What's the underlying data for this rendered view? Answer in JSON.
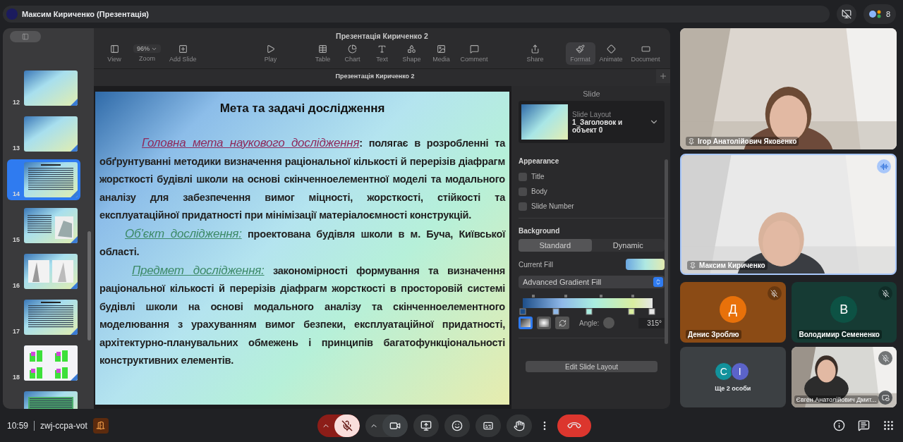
{
  "presenter_bar": {
    "label": "Максим Кириченко (Презентація)"
  },
  "top_controls": {
    "participants_count": "8"
  },
  "keynote": {
    "window_title": "Презентація Кириченко 2",
    "toolbar": [
      {
        "kind": "view",
        "label": "View",
        "selected": false
      },
      {
        "kind": "zoom",
        "label": "Zoom",
        "value": "96%",
        "selected": false
      },
      {
        "kind": "add_slide",
        "label": "Add Slide",
        "selected": false
      },
      {
        "kind": "play",
        "label": "Play",
        "selected": false
      },
      {
        "kind": "table",
        "label": "Table",
        "selected": false
      },
      {
        "kind": "chart",
        "label": "Chart",
        "selected": false
      },
      {
        "kind": "text",
        "label": "Text",
        "selected": false
      },
      {
        "kind": "shape",
        "label": "Shape",
        "selected": false
      },
      {
        "kind": "media",
        "label": "Media",
        "selected": false
      },
      {
        "kind": "comment",
        "label": "Comment",
        "selected": false
      },
      {
        "kind": "share",
        "label": "Share",
        "selected": false
      },
      {
        "kind": "format",
        "label": "Format",
        "selected": true
      },
      {
        "kind": "animate",
        "label": "Animate",
        "selected": false
      },
      {
        "kind": "document",
        "label": "Document",
        "selected": false
      }
    ],
    "document_tab": "Презентація Кириченко 2",
    "slides": [
      {
        "number": "12",
        "kind": "gradient",
        "selected": false
      },
      {
        "number": "13",
        "kind": "gradient",
        "selected": false
      },
      {
        "number": "14",
        "kind": "text",
        "selected": true
      },
      {
        "number": "15",
        "kind": "diagram",
        "selected": false
      },
      {
        "number": "16",
        "kind": "photos",
        "selected": false
      },
      {
        "number": "17",
        "kind": "text",
        "selected": false
      },
      {
        "number": "18",
        "kind": "charts",
        "selected": false
      },
      {
        "kind": "table",
        "selected": false
      }
    ],
    "slide": {
      "title": "Мета та задачі дослідження",
      "paragraphs": [
        {
          "lead": "Головна мета наукового дослідження",
          "color": "#8e2a5c",
          "text": ": полягає в розробленні та обґрунтуванні методики визначення раціональної кількості й перерізів діафрагм жорсткості будівлі школи на основі скінченноелементної моделі та модального аналізу для забезпечення вимог міцності, жорсткості, стійкості та експлуатаційної придатності при мінімізації матеріалоємності конструкцій."
        },
        {
          "lead": "Об’єкт дослідження:",
          "color": "#3d8a68",
          "text": " проектована будівля школи в м. Буча, Київської області."
        },
        {
          "lead": "Предмет дослідження:",
          "color": "#3d8a68",
          "text": " закономірності формування та визначення раціональної кількості й перерізів діафрагм жорсткості в просторовій системі будівлі школи на основі модального аналізу та скінченноелементного моделювання з урахуванням вимог безпеки, експлуатаційної придатності, архітектурно-планувальних обмежень і принципів багатофункціональності конструктивних елементів."
        }
      ]
    },
    "inspector": {
      "header": "Slide",
      "layout_label": "Slide Layout",
      "layout_value": "1_Заголовок и объект 0",
      "appearance": {
        "heading": "Appearance",
        "options": [
          {
            "label": "Title",
            "checked": false
          },
          {
            "label": "Body",
            "checked": false
          },
          {
            "label": "Slide Number",
            "checked": false
          }
        ]
      },
      "background": {
        "heading": "Background",
        "segments": [
          {
            "label": "Standard",
            "selected": true
          },
          {
            "label": "Dynamic",
            "selected": false
          }
        ]
      },
      "current_fill_label": "Current Fill",
      "fill_type": "Advanced Gradient Fill",
      "angle_label": "Angle:",
      "angle_value": "315°",
      "edit_button": "Edit Slide Layout"
    }
  },
  "tiles": [
    {
      "kind": "video",
      "name": "Ігор Анатолійович Яковенко",
      "pinned": true,
      "muted": false,
      "speaking": false
    },
    {
      "kind": "video",
      "name": "Максим Кириченко",
      "pinned": true,
      "speaking": true
    },
    {
      "kind": "avatar",
      "name": "Денис Зроблю",
      "initial": "Д",
      "color": "#e8710a",
      "muted": true
    },
    {
      "kind": "avatar",
      "name": "Володимир Семененко",
      "initial": "В",
      "color": "#0d5244",
      "muted": true
    },
    {
      "kind": "group",
      "label": "Ще 2 особи",
      "members": [
        {
          "initial": "С",
          "color": "#12929c"
        },
        {
          "initial": "І",
          "color": "#5b63c9"
        }
      ]
    },
    {
      "kind": "video",
      "name": "Євген Анатолійович Дмит...",
      "pinned": false,
      "muted": true
    }
  ],
  "bottom_bar": {
    "time": "10:59",
    "meeting_code": "zwj-ccpa-vot",
    "mic": {
      "muted": true
    },
    "camera": {
      "muted": false
    },
    "controls": [
      {
        "kind": "present"
      },
      {
        "kind": "emoji"
      },
      {
        "kind": "captions"
      },
      {
        "kind": "hand"
      },
      {
        "kind": "more"
      },
      {
        "kind": "leave"
      }
    ],
    "side_controls": [
      {
        "kind": "info"
      },
      {
        "kind": "chat"
      },
      {
        "kind": "apps"
      }
    ]
  }
}
